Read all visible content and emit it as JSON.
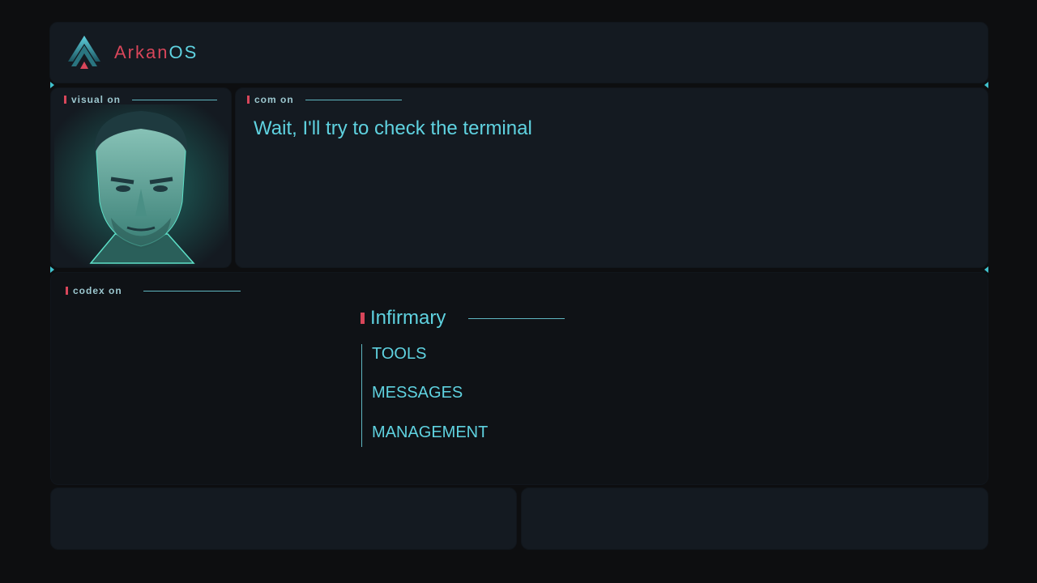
{
  "header": {
    "brand_part1": "Arkan",
    "brand_part2": "OS",
    "logo_icon": "triangle-logo-icon"
  },
  "visual": {
    "label": "visual on",
    "portrait": "man-face-portrait"
  },
  "com": {
    "label": "com on",
    "message": "Wait, I'll try to check the terminal"
  },
  "codex": {
    "label": "codex on",
    "menu_title": "Infirmary",
    "menu_items": [
      {
        "label": "TOOLS"
      },
      {
        "label": "MESSAGES"
      },
      {
        "label": "MANAGEMENT"
      }
    ]
  },
  "colors": {
    "accent_red": "#d8465a",
    "accent_cyan": "#5fd2e0",
    "panel": "#141a21",
    "background": "#0d0e10"
  }
}
